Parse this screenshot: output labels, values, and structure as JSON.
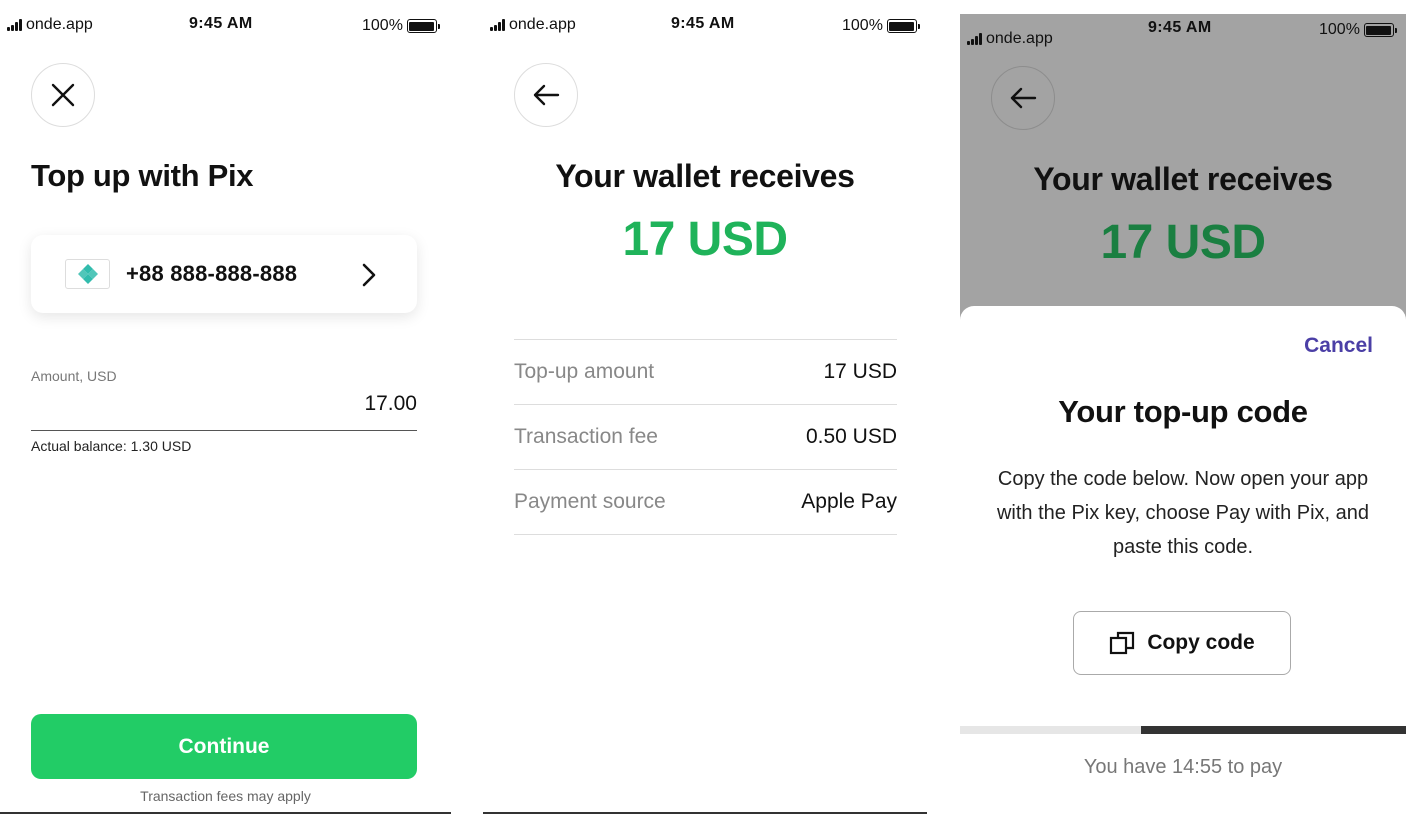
{
  "status_bar": {
    "carrier": "onde.app",
    "time": "9:45 AM",
    "battery": "100%",
    "battery_level": 1.0
  },
  "screen1": {
    "close_icon": "close-icon",
    "title": "Top up with Pix",
    "pix_key": {
      "icon": "pix-logo-icon",
      "phone": "+88 888-888-888",
      "chevron_icon": "chevron-right-icon"
    },
    "amount_label": "Amount, USD",
    "amount_value": "17.00",
    "balance_text": "Actual balance: 1.30 USD",
    "continue_label": "Continue",
    "fees_note": "Transaction fees may apply"
  },
  "screen2": {
    "back_icon": "arrow-left-icon",
    "title": "Your wallet receives",
    "amount": "17 USD",
    "details": [
      {
        "label": "Top-up amount",
        "value": "17 USD"
      },
      {
        "label": "Transaction fee",
        "value": "0.50 USD"
      },
      {
        "label": "Payment source",
        "value": "Apple Pay"
      }
    ]
  },
  "screen3": {
    "back_icon": "arrow-left-icon",
    "title": "Your wallet receives",
    "amount": "17 USD",
    "cancel_label": "Cancel",
    "sheet_title": "Your top-up code",
    "sheet_description": "Copy the code below. Now open your app with the Pix key, choose Pay with Pix, and paste this code.",
    "copy_icon": "copy-icon",
    "copy_label": "Copy code",
    "timer_progress": 0.595,
    "timer_text": "You have 14:55 to pay"
  },
  "colors": {
    "accent_green": "#22cc66",
    "amount_green": "#1fb35a",
    "cancel_purple": "#4b3fa6",
    "pix_teal": "#32bcad"
  }
}
